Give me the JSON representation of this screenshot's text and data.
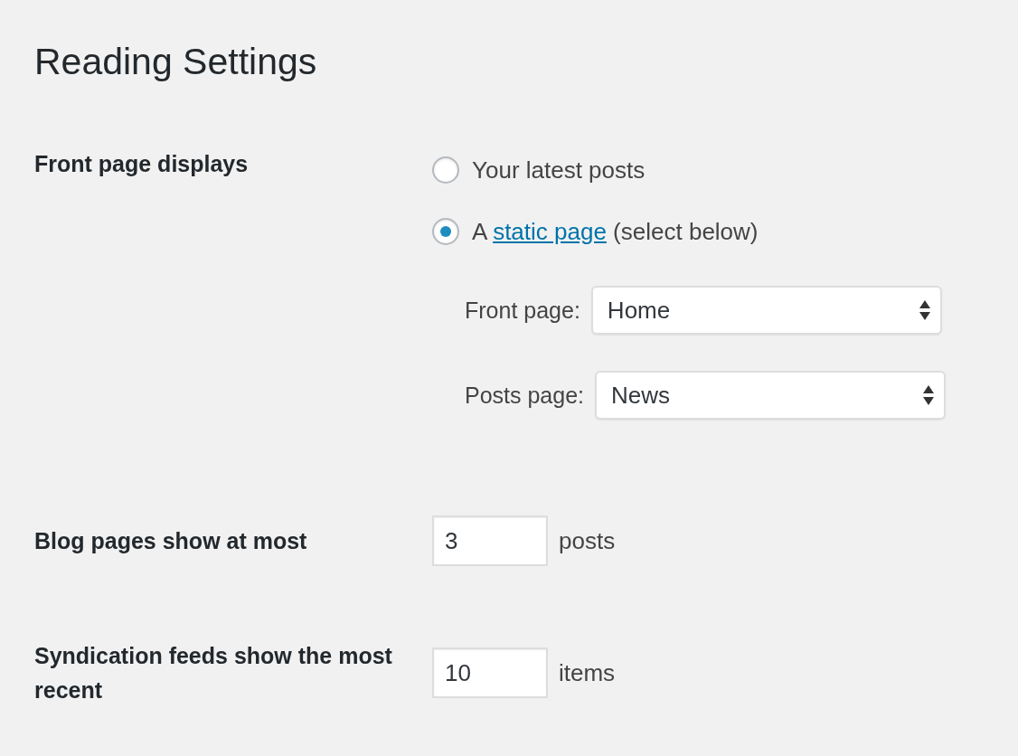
{
  "title": "Reading Settings",
  "front_page_displays": {
    "label": "Front page displays",
    "options": [
      {
        "kind": "plain",
        "text": "Your latest posts",
        "selected": false
      },
      {
        "kind": "link",
        "text_before": "A",
        "link": "static page",
        "text_after": "(select below)",
        "selected": true
      }
    ],
    "selects": [
      {
        "label": "Front page:",
        "value": "Home"
      },
      {
        "label": "Posts page:",
        "value": "News"
      }
    ]
  },
  "number_rows": [
    {
      "label": "Blog pages show at most",
      "value": "3",
      "unit": "posts"
    },
    {
      "label": "Syndication feeds show the most recent",
      "value": "10",
      "unit": "items"
    }
  ]
}
